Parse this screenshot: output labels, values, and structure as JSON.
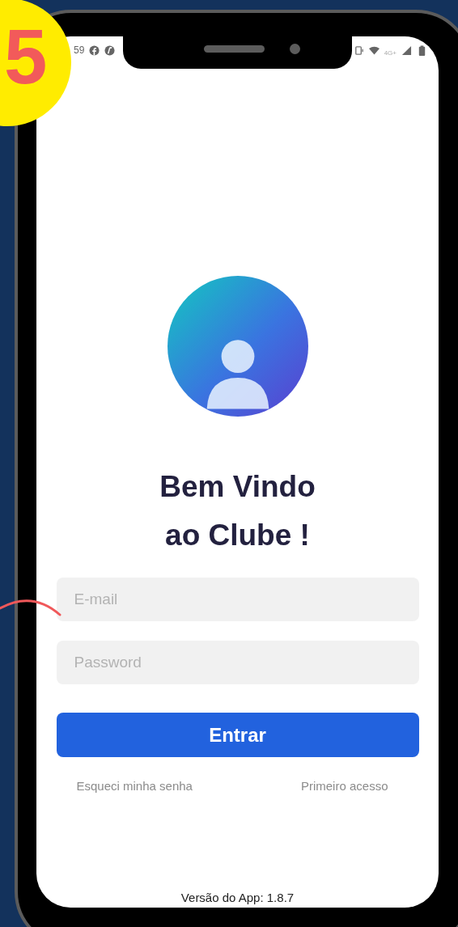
{
  "badge": {
    "number": "5"
  },
  "status_bar": {
    "time": "59",
    "network": "4G+"
  },
  "login": {
    "title": "Bem Vindo\nao Clube !",
    "fields": [
      {
        "placeholder": "E-mail"
      },
      {
        "placeholder": "Password"
      }
    ],
    "button": "Entrar",
    "links": [
      "Esqueci minha senha",
      "Primeiro acesso"
    ],
    "version": "Versão do App: 1.8.7"
  }
}
